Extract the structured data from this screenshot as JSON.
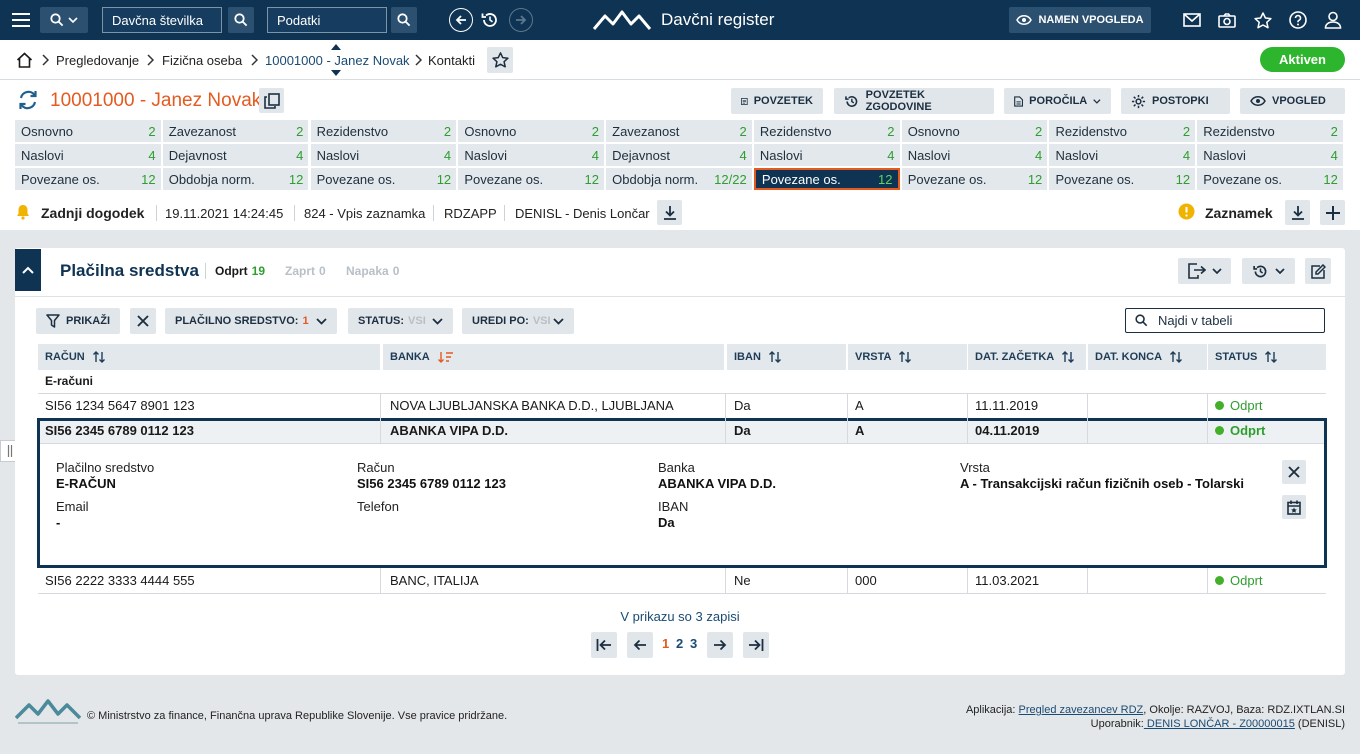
{
  "topbar": {
    "search_type": "Davčna številka",
    "search_query": "Podatki",
    "app_title": "Davčni register",
    "purpose_button": "NAMEN VPOGLEDA"
  },
  "breadcrumb": {
    "items": [
      "Pregledovanje",
      "Fizična oseba",
      "10001000 - Janez Novak",
      "Kontakti"
    ],
    "status": "Aktiven"
  },
  "person": {
    "title": "10001000 - Janez Novak"
  },
  "actions": {
    "summary": "POVZETEK",
    "history_summary": "POVZETEK ZGODOVINE",
    "reports": "POROČILA",
    "procedures": "POSTOPKI",
    "view": "VPOGLED"
  },
  "grid": {
    "rows": [
      [
        [
          "Osnovno",
          "2"
        ],
        [
          "Zavezanost",
          "2"
        ],
        [
          "Rezidenstvo",
          "2"
        ],
        [
          "Osnovno",
          "2"
        ],
        [
          "Zavezanost",
          "2"
        ],
        [
          "Rezidenstvo",
          "2"
        ],
        [
          "Osnovno",
          "2"
        ],
        [
          "Rezidenstvo",
          "2"
        ],
        [
          "Rezidenstvo",
          "2"
        ]
      ],
      [
        [
          "Naslovi",
          "4"
        ],
        [
          "Dejavnost",
          "4"
        ],
        [
          "Naslovi",
          "4"
        ],
        [
          "Naslovi",
          "4"
        ],
        [
          "Dejavnost",
          "4"
        ],
        [
          "Naslovi",
          "4"
        ],
        [
          "Naslovi",
          "4"
        ],
        [
          "Naslovi",
          "4"
        ],
        [
          "Naslovi",
          "4"
        ]
      ],
      [
        [
          "Povezane os.",
          "12"
        ],
        [
          "Obdobja norm.",
          "12"
        ],
        [
          "Povezane os.",
          "12"
        ],
        [
          "Povezane os.",
          "12"
        ],
        [
          "Obdobja norm.",
          "12/22"
        ],
        [
          "Povezane os.",
          "12"
        ],
        [
          "Povezane os.",
          "12"
        ],
        [
          "Povezane os.",
          "12"
        ],
        [
          "Povezane os.",
          "12"
        ]
      ]
    ]
  },
  "event": {
    "label": "Zadnji dogodek",
    "datetime": "19.11.2021 14:24:45",
    "code": "824 - Vpis zaznamka",
    "user_code": "RDZAPP",
    "user": "DENISL - Denis Lončar",
    "note_label": "Zaznamek"
  },
  "section": {
    "title": "Plačilna sredstva",
    "tab_open": "Odprt",
    "tab_open_count": "19",
    "tab_closed": "Zaprt",
    "tab_closed_count": "0",
    "tab_error": "Napaka",
    "tab_error_count": "0"
  },
  "filters": {
    "show": "PRIKAŽI",
    "payment": "PLAČILNO SREDSTVO:",
    "payment_val": "1",
    "status": "STATUS:",
    "status_val": "VSI",
    "sort": "UREDI PO:",
    "sort_val": "VSI",
    "search_placeholder": "Najdi v tabeli"
  },
  "table": {
    "headers": [
      "RAČUN",
      "BANKA",
      "IBAN",
      "VRSTA",
      "DAT. ZAČETKA",
      "DAT. KONCA",
      "STATUS"
    ],
    "group": "E-računi",
    "rows": [
      [
        "SI56 1234 5647 8901 123",
        "NOVA LJUBLJANSKA BANKA D.D., LJUBLJANA",
        "Da",
        "A",
        "11.11.2019",
        "",
        "Odprt"
      ],
      [
        "SI56 2345 6789 0112 123",
        "ABANKA VIPA D.D.",
        "Da",
        "A",
        "04.11.2019",
        "",
        "Odprt"
      ],
      [
        "SI56 2222 3333 4444 555",
        "BANC, ITALIJA",
        "Ne",
        "000",
        "11.03.2021",
        "",
        "Odprt"
      ]
    ]
  },
  "detail": {
    "l1": "Plačilno sredstvo",
    "v1": "E-RAČUN",
    "l2": "Račun",
    "v2": "SI56 2345 6789 0112 123",
    "l3": "Banka",
    "v3": "ABANKA VIPA D.D.",
    "l4": "Vrsta",
    "v4": "A - Transakcijski račun fizičnih oseb - Tolarski",
    "l5": "Email",
    "v5": "-",
    "l6": "Telefon",
    "l7": "IBAN",
    "v7": "Da"
  },
  "pager": {
    "summary": "V prikazu so 3 zapisi",
    "p1": "1",
    "p2": "2",
    "p3": "3"
  },
  "footer": {
    "copyright": "© Ministrstvo za finance, Finančna uprava Republike Slovenije. Vse pravice pridržane.",
    "app_label": "Aplikacija:",
    "app_link": "Pregled zavezancev RDZ",
    "app_rest": ", Okolje: RAZVOJ, Baza: RDZ.IXTLAN.SI",
    "user_label": "Uporabnik:",
    "user_link": " DENIS LONČAR - Z00000015",
    "user_rest": " (DENISL)"
  },
  "colors": {
    "nav": "#0f3352",
    "accent_orange": "#e45a1f",
    "success": "#2e9e2e",
    "status_green": "#43b02a"
  }
}
